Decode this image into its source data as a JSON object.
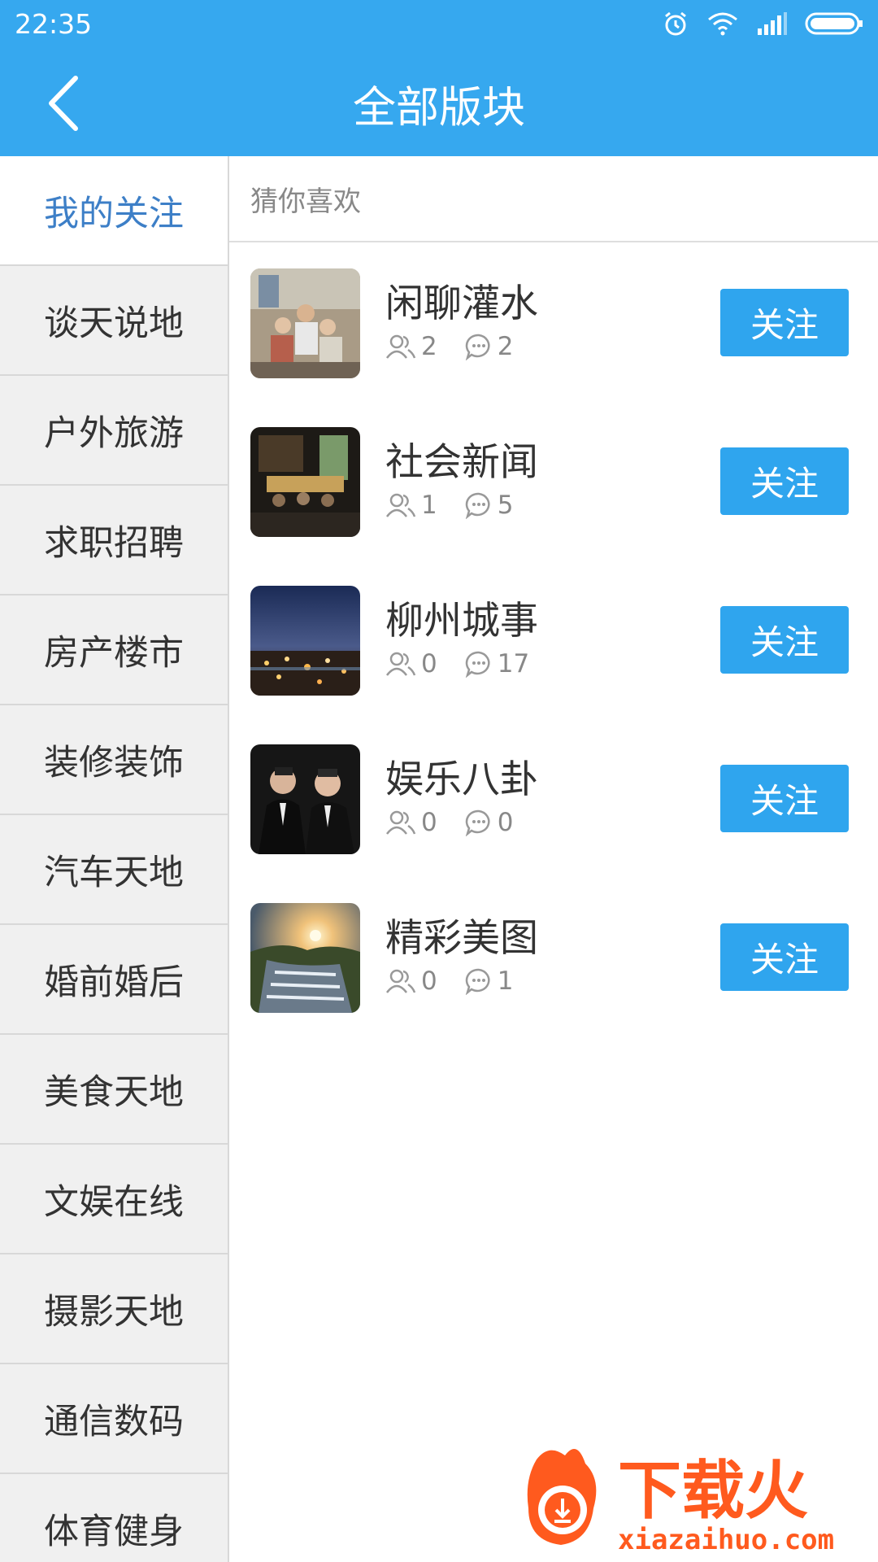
{
  "status": {
    "time": "22:35"
  },
  "header": {
    "title": "全部版块"
  },
  "sidebar": {
    "items": [
      {
        "label": "我的关注"
      },
      {
        "label": "谈天说地"
      },
      {
        "label": "户外旅游"
      },
      {
        "label": "求职招聘"
      },
      {
        "label": "房产楼市"
      },
      {
        "label": "装修装饰"
      },
      {
        "label": "汽车天地"
      },
      {
        "label": "婚前婚后"
      },
      {
        "label": "美食天地"
      },
      {
        "label": "文娱在线"
      },
      {
        "label": "摄影天地"
      },
      {
        "label": "通信数码"
      },
      {
        "label": "体育健身"
      }
    ]
  },
  "main": {
    "section_title": "猜你喜欢",
    "forums": [
      {
        "name": "闲聊灌水",
        "members": "2",
        "posts": "2",
        "follow_label": "关注"
      },
      {
        "name": "社会新闻",
        "members": "1",
        "posts": "5",
        "follow_label": "关注"
      },
      {
        "name": "柳州城事",
        "members": "0",
        "posts": "17",
        "follow_label": "关注"
      },
      {
        "name": "娱乐八卦",
        "members": "0",
        "posts": "0",
        "follow_label": "关注"
      },
      {
        "name": "精彩美图",
        "members": "0",
        "posts": "1",
        "follow_label": "关注"
      }
    ]
  },
  "watermark": {
    "brand": "下载火",
    "site": "xiazaihuo.com"
  },
  "colors": {
    "accent": "#36a8ef",
    "button": "#2fa5ee",
    "active_text": "#3d7fc7"
  }
}
